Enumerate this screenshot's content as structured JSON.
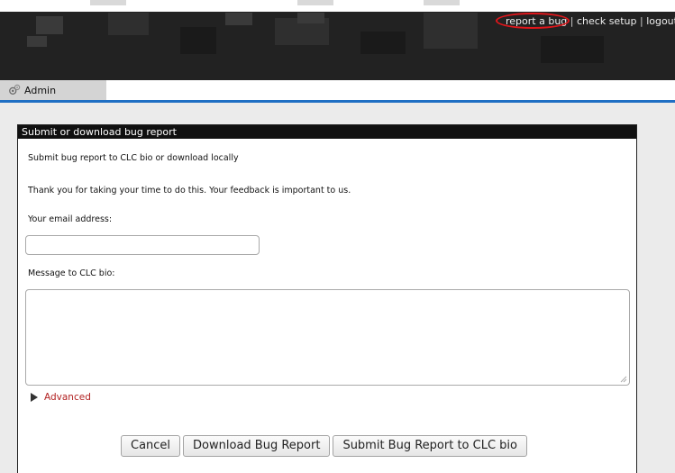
{
  "header": {
    "links": [
      {
        "label": "report a bug"
      },
      {
        "label": "check setup"
      },
      {
        "label": "logout roo"
      }
    ],
    "separator": "|"
  },
  "tabs": [
    {
      "label": "Admin",
      "icon": "gear-icon"
    }
  ],
  "panel": {
    "title": "Submit or download bug report",
    "intro": "Submit bug report to CLC bio or download locally",
    "thanks": "Thank you for taking your time to do this. Your feedback is important to us.",
    "email_label": "Your email address:",
    "email_value": "",
    "message_label": "Message to CLC bio:",
    "message_value": "",
    "advanced_label": "Advanced"
  },
  "buttons": {
    "cancel": "Cancel",
    "download": "Download Bug Report",
    "submit": "Submit Bug Report to CLC bio"
  },
  "colors": {
    "accent_blue": "#1f6fc4",
    "advanced_link": "#b22222",
    "annotation_circle": "#e0161b"
  }
}
